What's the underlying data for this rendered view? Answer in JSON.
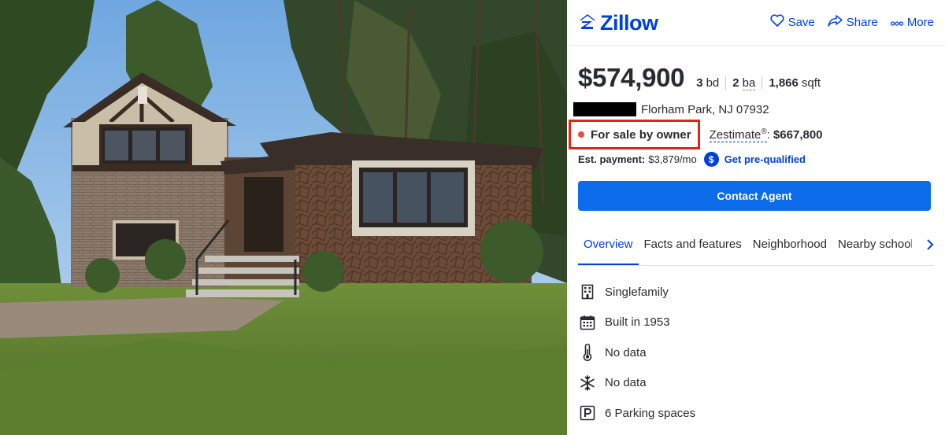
{
  "header": {
    "brand": "Zillow",
    "save_label": "Save",
    "share_label": "Share",
    "more_label": "More"
  },
  "listing": {
    "price": "$574,900",
    "beds_value": "3",
    "beds_unit": "bd",
    "baths_value": "2",
    "baths_unit": "ba",
    "sqft_value": "1,866",
    "sqft_unit": "sqft",
    "address": "Florham Park, NJ 07932",
    "status": "For sale by owner",
    "zestimate_label": "Zestimate",
    "zestimate_mark": "®",
    "zestimate_sep": ":",
    "zestimate_value": "$667,800",
    "payment_label": "Est. payment:",
    "payment_value": "$3,879/mo",
    "dollar_badge": "$",
    "prequal_label": "Get pre-qualified",
    "contact_label": "Contact Agent"
  },
  "tabs": [
    {
      "label": "Overview"
    },
    {
      "label": "Facts and features"
    },
    {
      "label": "Neighborhood"
    },
    {
      "label": "Nearby schools"
    }
  ],
  "features": [
    {
      "icon": "building-icon",
      "label": "Singlefamily"
    },
    {
      "icon": "calendar-icon",
      "label": "Built in 1953"
    },
    {
      "icon": "thermometer-icon",
      "label": "No data"
    },
    {
      "icon": "snowflake-icon",
      "label": "No data"
    },
    {
      "icon": "parking-icon",
      "label": "6 Parking spaces"
    }
  ],
  "colors": {
    "brand_blue": "#0041d9",
    "button_blue": "#0b6be8",
    "status_dot": "#e84c3d",
    "highlight_box": "#e8221b"
  }
}
